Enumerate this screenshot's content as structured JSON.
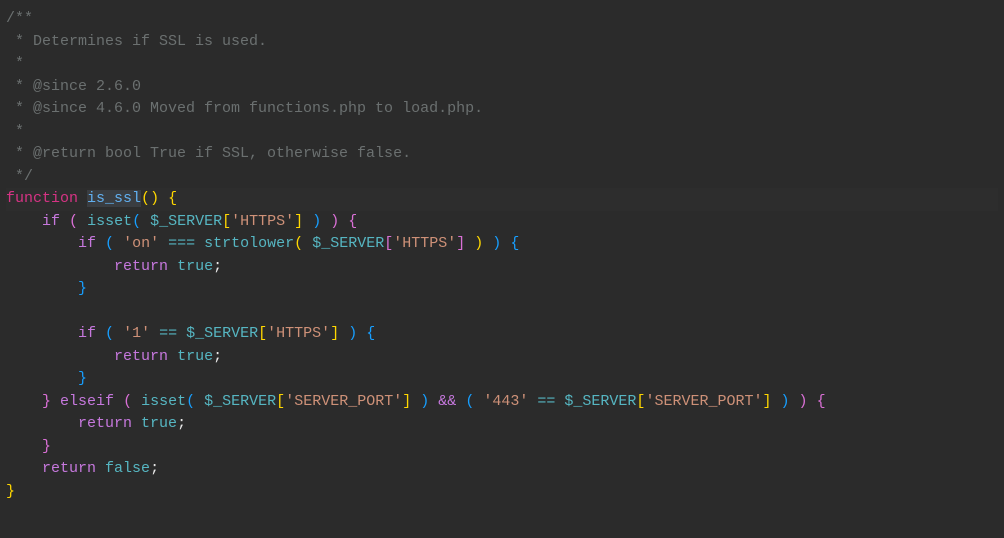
{
  "code": {
    "comment_lines": {
      "open": "/**",
      "line1": " * Determines if SSL is used.",
      "line2": " *",
      "line3": " * @since 2.6.0",
      "line4": " * @since 4.6.0 Moved from functions.php to load.php.",
      "line5": " *",
      "line6": " * @return bool True if SSL, otherwise false.",
      "close": " */"
    },
    "keywords": {
      "function": "function",
      "if": "if",
      "elseif": "elseif",
      "return": "return",
      "true": "true",
      "false": "false"
    },
    "function_name": "is_ssl",
    "function_calls": {
      "isset": "isset",
      "strtolower": "strtolower"
    },
    "variables": {
      "server": "$_SERVER"
    },
    "strings": {
      "https": "'HTTPS'",
      "on": "'on'",
      "one": "'1'",
      "server_port": "'SERVER_PORT'",
      "port443": "'443'"
    },
    "operators": {
      "strict_eq": "===",
      "eq": "==",
      "and": "&&"
    },
    "punctuation": {
      "paren_open": "(",
      "paren_close": ")",
      "brace_open": "{",
      "brace_close": "}",
      "bracket_open": "[",
      "bracket_close": "]",
      "semicolon": ";"
    }
  }
}
